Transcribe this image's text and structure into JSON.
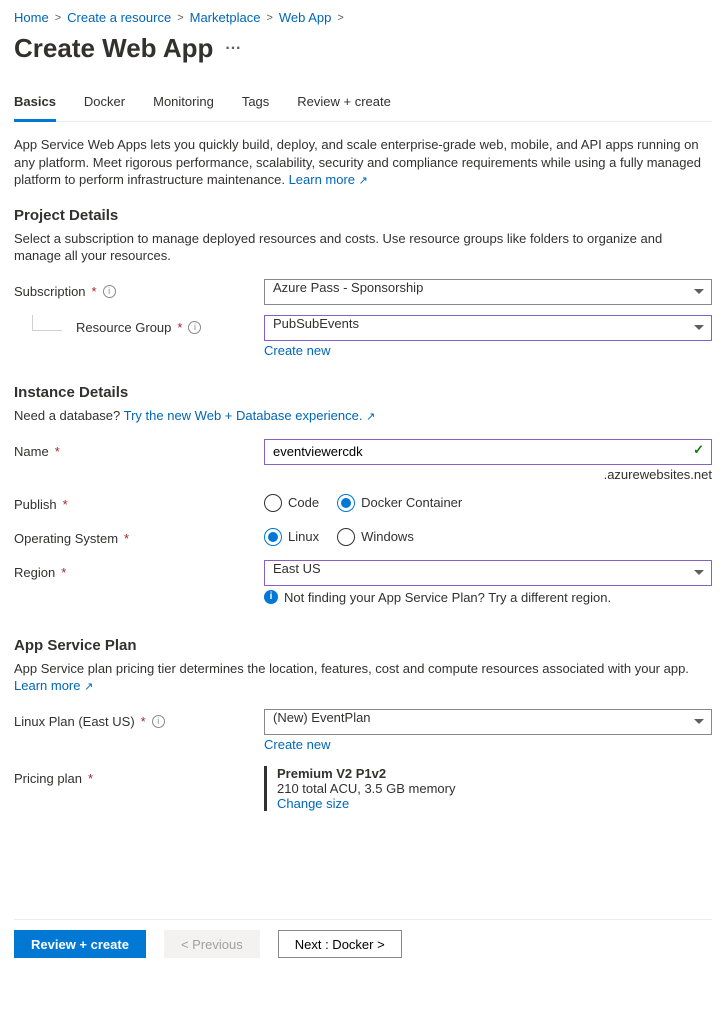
{
  "breadcrumb": {
    "items": [
      "Home",
      "Create a resource",
      "Marketplace",
      "Web App"
    ]
  },
  "page": {
    "title": "Create Web App",
    "more": "···"
  },
  "tabs": {
    "items": [
      "Basics",
      "Docker",
      "Monitoring",
      "Tags",
      "Review + create"
    ],
    "active": 0
  },
  "intro": {
    "text": "App Service Web Apps lets you quickly build, deploy, and scale enterprise-grade web, mobile, and API apps running on any platform. Meet rigorous performance, scalability, security and compliance requirements while using a fully managed platform to perform infrastructure maintenance.  ",
    "learn_more": "Learn more"
  },
  "project_details": {
    "heading": "Project Details",
    "desc": "Select a subscription to manage deployed resources and costs. Use resource groups like folders to organize and manage all your resources.",
    "subscription_label": "Subscription",
    "subscription_value": "Azure Pass - Sponsorship",
    "resource_group_label": "Resource Group",
    "resource_group_value": "PubSubEvents",
    "create_new": "Create new"
  },
  "instance_details": {
    "heading": "Instance Details",
    "db_prompt": "Need a database? ",
    "db_link": "Try the new Web + Database experience.",
    "name_label": "Name",
    "name_value": "eventviewercdk",
    "domain_suffix": ".azurewebsites.net",
    "publish_label": "Publish",
    "publish_options": [
      "Code",
      "Docker Container"
    ],
    "publish_selected": 1,
    "os_label": "Operating System",
    "os_options": [
      "Linux",
      "Windows"
    ],
    "os_selected": 0,
    "region_label": "Region",
    "region_value": "East US",
    "region_hint": "Not finding your App Service Plan? Try a different region."
  },
  "app_service_plan": {
    "heading": "App Service Plan",
    "desc": "App Service plan pricing tier determines the location, features, cost and compute resources associated with your app. ",
    "learn_more": "Learn more",
    "linux_plan_label": "Linux Plan (East US)",
    "linux_plan_value": "(New) EventPlan",
    "create_new": "Create new",
    "pricing_label": "Pricing plan",
    "pricing_title": "Premium V2 P1v2",
    "pricing_specs": "210 total ACU, 3.5 GB memory",
    "change_size": "Change size"
  },
  "footer": {
    "review_create": "Review + create",
    "previous": "< Previous",
    "next": "Next : Docker >"
  },
  "icons": {
    "info": "i",
    "ext": "↗",
    "hint": "i"
  }
}
